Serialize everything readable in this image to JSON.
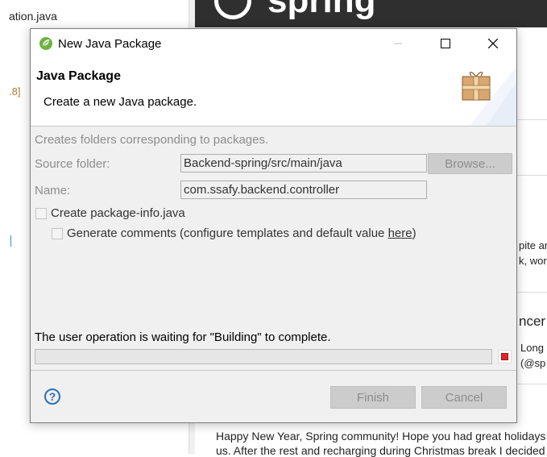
{
  "background": {
    "file_tab": "ation.java",
    "version_fragment": ".8]",
    "banner_text": "spring",
    "right_snippets": [
      "pite ar",
      "k, wor",
      "ncer",
      "Long",
      "(@sp"
    ],
    "blog_line1": "Happy New Year, Spring community! Hope you had great holidays a",
    "blog_line2": "us. After the rest and recharging during Christmas break I decided t"
  },
  "dialog": {
    "title": "New Java Package",
    "header_title": "Java Package",
    "header_description": "Create a new Java package.",
    "info_text": "Creates folders corresponding to packages.",
    "source_folder_label": "Source folder:",
    "source_folder_value": "Backend-spring/src/main/java",
    "browse_label": "Browse...",
    "name_label": "Name:",
    "name_value": "com.ssafy.backend.controller",
    "create_package_info_label": "Create package-info.java",
    "generate_comments_label": "Generate comments (configure templates and default value ",
    "generate_comments_link": "here",
    "generate_comments_suffix": ")",
    "status_text": "The user operation is waiting for \"Building\" to complete.",
    "help_glyph": "?",
    "finish_label": "Finish",
    "cancel_label": "Cancel"
  },
  "colors": {
    "dialog_bg": "#f0f0f0",
    "disabled_text": "#8d8d8d",
    "stop_red": "#e0262b",
    "help_blue": "#2f6fb4",
    "spring_green": "#6db33f"
  },
  "icons": {
    "title": "spring-leaf-icon",
    "header": "package-gift-icon",
    "help": "help-question-icon",
    "stop": "stop-icon"
  }
}
